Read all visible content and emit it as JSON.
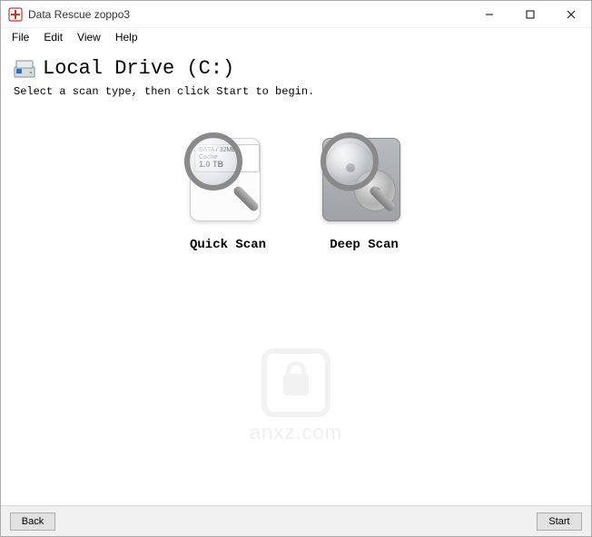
{
  "window": {
    "title": "Data Rescue zoppo3"
  },
  "menu": {
    "file": "File",
    "edit": "Edit",
    "view": "View",
    "help": "Help"
  },
  "header": {
    "drive_title": "Local Drive (C:)",
    "instruction": "Select a scan type, then click Start to begin."
  },
  "scan": {
    "quick_label": "Quick Scan",
    "quick_disk_text_line1": "SATA / 32MB Cache",
    "quick_disk_text_line2": "1.0 TB",
    "deep_label": "Deep Scan"
  },
  "footer": {
    "back": "Back",
    "start": "Start"
  },
  "watermark": {
    "text": "anxz.com"
  }
}
